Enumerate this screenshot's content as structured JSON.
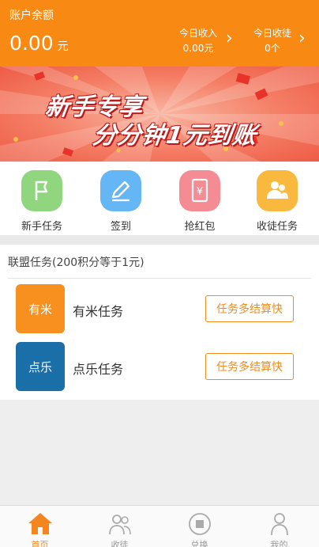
{
  "header": {
    "balance_label": "账户余额",
    "balance_amount": "0.00",
    "balance_unit": "元",
    "income_label": "今日收入",
    "income_value": "0.00元",
    "invite_label": "今日收徒",
    "invite_value": "0个"
  },
  "banner": {
    "line1": "新手专享",
    "line2": "分分钟1元到账"
  },
  "actions": [
    {
      "label": "新手任务",
      "icon": "flag-icon",
      "color": "#8fd67f"
    },
    {
      "label": "签到",
      "icon": "pencil-icon",
      "color": "#64b7f4"
    },
    {
      "label": "抢红包",
      "icon": "yen-envelope-icon",
      "color": "#f58c93"
    },
    {
      "label": "收徒任务",
      "icon": "people-icon",
      "color": "#f9b93e"
    }
  ],
  "alliance": {
    "title": "联盟任务(200积分等于1元)",
    "tasks": [
      {
        "logo_text": "有米",
        "name": "有米任务",
        "button": "任务多结算快",
        "logo_color": "#f7901e"
      },
      {
        "logo_text": "点乐",
        "name": "点乐任务",
        "button": "任务多结算快",
        "logo_color": "#1a6fa8"
      }
    ]
  },
  "tabbar": [
    {
      "label": "首页",
      "icon": "home-icon",
      "active": true
    },
    {
      "label": "收徒",
      "icon": "users-icon",
      "active": false
    },
    {
      "label": "兑换",
      "icon": "exchange-icon",
      "active": false
    },
    {
      "label": "我的",
      "icon": "user-icon",
      "active": false
    }
  ],
  "colors": {
    "accent": "#f88a14",
    "active_tab": "#f5861f"
  }
}
